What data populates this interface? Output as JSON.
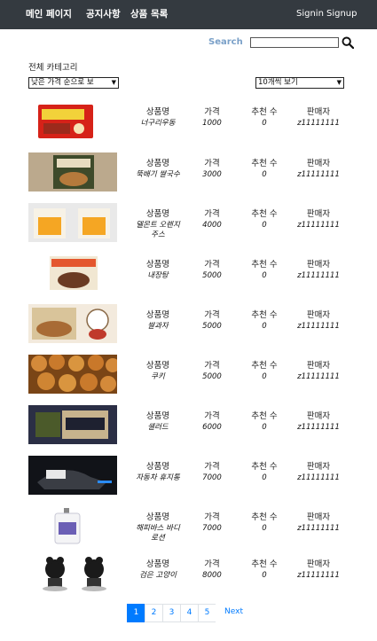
{
  "nav": {
    "home": "메인 페이지",
    "notice": "공지사항",
    "products": "상품 목록",
    "signin": "Signin",
    "signup": "Signup"
  },
  "search": {
    "label": "Search",
    "value": "",
    "icon": "search-icon"
  },
  "category": {
    "title": "전체 카테고리"
  },
  "filters": {
    "sort": "낮은 가격 순으로 보",
    "page_size": "10개씩 보기"
  },
  "columns": {
    "name": "상품명",
    "price": "가격",
    "recommend": "추천 수",
    "seller": "판매자"
  },
  "products": [
    {
      "name": "너구리우동",
      "price": "1000",
      "recommend": "0",
      "seller": "z11111111"
    },
    {
      "name": "뚝배기 쌀국수",
      "price": "3000",
      "recommend": "0",
      "seller": "z11111111"
    },
    {
      "name": "델몬트 오렌지 주스",
      "price": "4000",
      "recommend": "0",
      "seller": "z11111111"
    },
    {
      "name": "내장탕",
      "price": "5000",
      "recommend": "0",
      "seller": "z11111111"
    },
    {
      "name": "쌀과자",
      "price": "5000",
      "recommend": "0",
      "seller": "z11111111"
    },
    {
      "name": "쿠키",
      "price": "5000",
      "recommend": "0",
      "seller": "z11111111"
    },
    {
      "name": "샐러드",
      "price": "6000",
      "recommend": "0",
      "seller": "z11111111"
    },
    {
      "name": "자동차 휴지통",
      "price": "7000",
      "recommend": "0",
      "seller": "z11111111"
    },
    {
      "name": "해피바스 바디로션",
      "price": "7000",
      "recommend": "0",
      "seller": "z11111111"
    },
    {
      "name": "검은 고양이",
      "price": "8000",
      "recommend": "0",
      "seller": "z11111111"
    }
  ],
  "pagination": {
    "pages": [
      "1",
      "2",
      "3",
      "4",
      "5"
    ],
    "next": "Next",
    "active": "1"
  }
}
